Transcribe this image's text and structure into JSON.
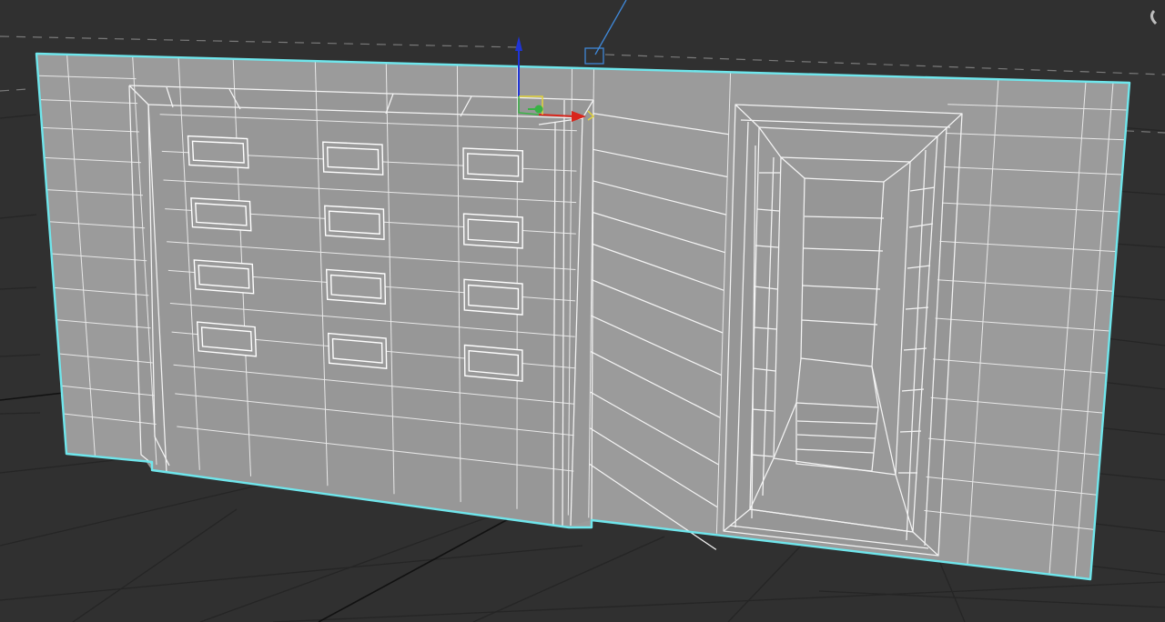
{
  "viewport": {
    "background": "#303030",
    "grid_color": "#252525",
    "grid_axis_color": "#111111",
    "horizon_color": "#7a7a7a"
  },
  "model": {
    "face_color": "#9b9b9b",
    "wire_color": "#f4f4f4",
    "selection_color": "#6fe6ec"
  },
  "gizmo": {
    "x_axis_color": "#d9261c",
    "y_axis_color": "#38b245",
    "z_axis_color": "#1f34d6",
    "plane_xy_color": "#e3d43a",
    "icon": "move-gizmo-icon"
  },
  "camera": {
    "target_color": "#3f88d8",
    "icon": "camera-target-icon"
  },
  "windows": {
    "rows": 4,
    "columns": 3
  }
}
